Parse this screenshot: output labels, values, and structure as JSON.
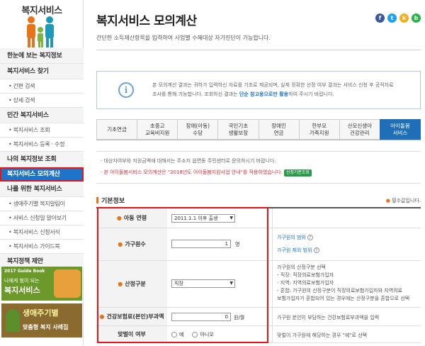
{
  "sidebar": {
    "title": "복지서비스",
    "items": [
      {
        "label": "한눈에 보는 복지정보",
        "kind": "sec"
      },
      {
        "label": "복지서비스 찾기",
        "kind": "sec"
      },
      {
        "label": "• 간편 검색",
        "kind": "sub"
      },
      {
        "label": "• 상세 검색",
        "kind": "sub"
      },
      {
        "label": "민간 복지서비스",
        "kind": "sec"
      },
      {
        "label": "• 복지서비스 조회",
        "kind": "sub"
      },
      {
        "label": "• 복지서비스 등록 · 수정",
        "kind": "sub"
      },
      {
        "label": "나의 복지정보 조회",
        "kind": "sec"
      },
      {
        "label": "복지서비스 모의계산",
        "kind": "active"
      },
      {
        "label": "나를 위한 복지서비스",
        "kind": "sec"
      },
      {
        "label": "• 생애주기별 복지알림이",
        "kind": "sub"
      },
      {
        "label": "• 서비스 신청일 알아보기",
        "kind": "sub"
      },
      {
        "label": "• 복지서비스 신청서식",
        "kind": "sub"
      },
      {
        "label": "• 복지서비스 가이드북",
        "kind": "sub"
      },
      {
        "label": "복지정책 제안",
        "kind": "sec"
      }
    ],
    "banner1": {
      "line1": "2017 Guide Book",
      "line2": "나에게 힘이 되는",
      "line3": "복지서비스"
    },
    "banner2": {
      "line1": "생애주기별",
      "line2": "맞춤형 복지 사례집"
    }
  },
  "header": {
    "title": "복지서비스 모의계산",
    "subtitle": "간단한 소득재산항목을 입력하여 사업별 수혜대상 자가진단이 가능합니다.",
    "social": [
      {
        "name": "facebook-icon",
        "glyph": "f",
        "color": "#3b5998"
      },
      {
        "name": "twitter-icon",
        "glyph": "t",
        "color": "#1da1f2"
      },
      {
        "name": "kakaostory-icon",
        "glyph": "k",
        "color": "#f2b01e"
      },
      {
        "name": "band-icon",
        "glyph": "b",
        "color": "#2bb34b"
      }
    ]
  },
  "info": {
    "line1": "본 모의계산 결과는 귀하가 입력하신 자료를 기초로 제공되며, 실제 정확한 선정 여부 결과는 서비스 신청 후 공적자료",
    "line2a": "조사를 통해 가능합니다. 조회하신 결과는 ",
    "line2b": "단순 참고용으로만 활용",
    "line2c": "하여 주시기 바랍니다."
  },
  "tabs": [
    {
      "label": "기초연금",
      "active": false
    },
    {
      "label": "초중고\n교육비지원",
      "active": false
    },
    {
      "label": "장애(아동)\n수당",
      "active": false
    },
    {
      "label": "국민기초\n생활보장",
      "active": false
    },
    {
      "label": "장애인\n연금",
      "active": false
    },
    {
      "label": "한부모\n가족지원",
      "active": false
    },
    {
      "label": "산모신생아\n건강관리",
      "active": false
    },
    {
      "label": "아이돌봄\n서비스",
      "active": true
    }
  ],
  "notes": {
    "n1": "· 대상자여부와 지원금액에 대해서는 주소지 읍면동 주민센터로 문의하시기 바랍니다.",
    "n2": "· 본 아이돌봄서비스 모의계산은 \"2018년도 아이돌봄지원사업 안내\"를 적용하였습니다.",
    "badge": "선정기준조회"
  },
  "form": {
    "section_title": "기본정보",
    "required_note": "필수값입니다.",
    "rows": {
      "age": {
        "label": "아동 연령",
        "select": "2011.1.1 이후 출생"
      },
      "members": {
        "label": "가구원수",
        "value": "1",
        "unit": "명",
        "link1": "가구원의 범위",
        "link2": "가구원 제외 범위"
      },
      "calc": {
        "label": "산정구분",
        "select": "직장",
        "desc": [
          "가구원의 산정구분 선택",
          "- 직장: 직장의료보험가입자",
          "- 지역: 지역의료보험가입자",
          "- 혼합: 가구원의 산정구분이 직장의료보험가입자와 지역의료",
          "보험가입자가 혼합되어 있는 경우에는 산정구분을 혼합으로 선택"
        ]
      },
      "premium": {
        "label": "건강보험료(본인)부과액",
        "value": "0",
        "unit": "원/월",
        "desc": "가구원 본인이 부담하는 건강보험료부과액을 입력"
      },
      "dual": {
        "label": "맞벌이 여부",
        "yes": "예",
        "no": "아니오",
        "desc": "맞벌이 가구원에 해당하는 경우 \"예\"로 선택"
      }
    }
  },
  "colors": {
    "accent": "#1e74c8",
    "highlight_border": "#e8131b",
    "active_tab": "#1e6fb8"
  }
}
